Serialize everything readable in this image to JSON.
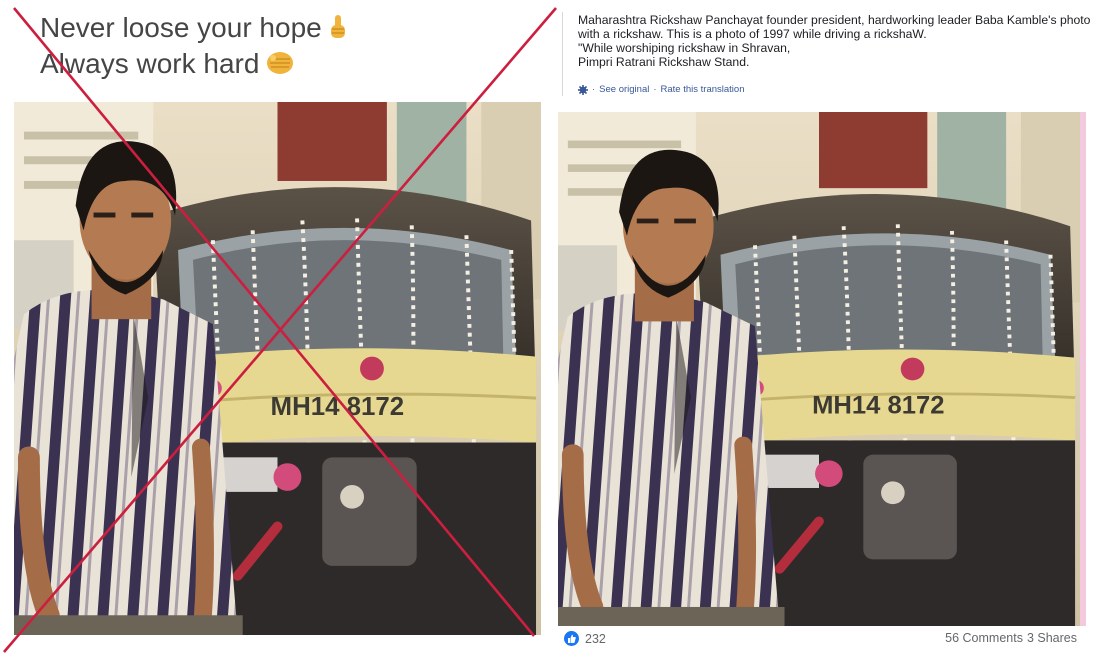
{
  "left_post": {
    "caption_line1": "Never loose your hope",
    "caption_line1_emoji": "finger-pointing-up",
    "caption_line2": "Always work hard",
    "caption_line2_emoji": "fist",
    "plate_text": "MH14 8172"
  },
  "right_post": {
    "text_lines": [
      "Maharashtra Rickshaw Panchayat founder president, hardworking leader Baba Kamble's photo",
      "with a rickshaw. This is a photo of 1997 while driving a rickshaW.",
      "\"While worshiping rickshaw in Shravan,",
      "Pimpri Ratrani Rickshaw Stand."
    ],
    "see_original": "See original",
    "separator": "·",
    "rate_translation": "Rate this translation",
    "plate_text": "MH14 8172",
    "like_count": "232",
    "comments": "56 Comments",
    "shares": "3 Shares"
  },
  "colors": {
    "cross_red": "#cc1f3f",
    "link_blue": "#385898",
    "like_blue": "#1877f2",
    "caption_gray": "#454545",
    "photo_border_pink": "#f3c9de"
  }
}
